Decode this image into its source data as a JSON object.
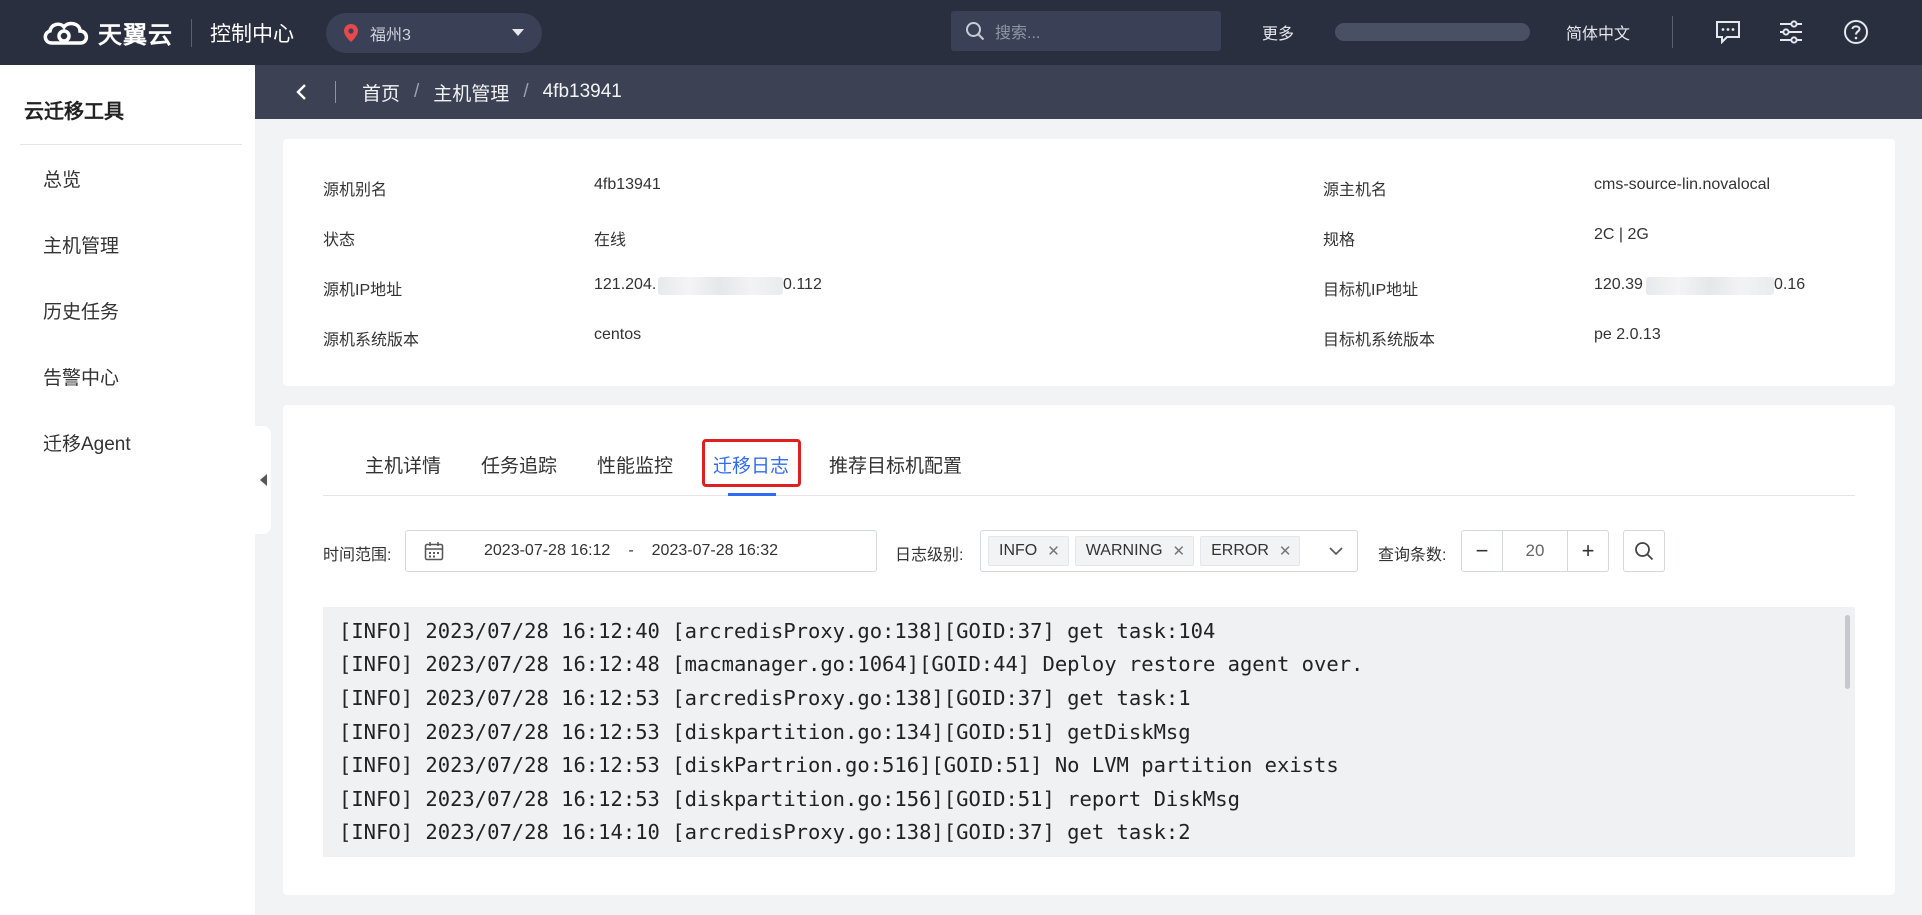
{
  "topbar": {
    "brand": "天翼云",
    "console": "控制中心",
    "region": "福州3",
    "search_placeholder": "搜索...",
    "more": "更多",
    "language": "简体中文"
  },
  "sidebar": {
    "title": "云迁移工具",
    "items": [
      {
        "label": "总览"
      },
      {
        "label": "主机管理"
      },
      {
        "label": "历史任务"
      },
      {
        "label": "告警中心"
      },
      {
        "label": "迁移Agent"
      }
    ]
  },
  "breadcrumb": [
    "首页",
    "主机管理",
    "4fb13941"
  ],
  "info": {
    "rows": [
      {
        "label_left": "源机别名",
        "value_left": "4fb13941",
        "label_right": "源主机名",
        "value_right": "cms-source-lin.novalocal"
      },
      {
        "label_left": "状态",
        "value_left": "在线",
        "label_right": "规格",
        "value_right": "2C | 2G"
      },
      {
        "label_left": "源机IP地址",
        "value_left_a": "121.204.",
        "value_left_b": "0.112",
        "label_right": "目标机IP地址",
        "value_right_a": "120.39",
        "value_right_b": "0.16"
      },
      {
        "label_left": "源机系统版本",
        "value_left": "centos",
        "label_right": "目标机系统版本",
        "value_right": "pe 2.0.13"
      }
    ]
  },
  "tabs": [
    {
      "label": "主机详情",
      "active": false
    },
    {
      "label": "任务追踪",
      "active": false
    },
    {
      "label": "性能监控",
      "active": false
    },
    {
      "label": "迁移日志",
      "active": true
    },
    {
      "label": "推荐目标机配置",
      "active": false
    }
  ],
  "filters": {
    "time_label": "时间范围:",
    "time_start": "2023-07-28 16:12",
    "time_sep": "-",
    "time_end": "2023-07-28 16:32",
    "level_label": "日志级别:",
    "levels": [
      "INFO",
      "WARNING",
      "ERROR"
    ],
    "count_label": "查询条数:",
    "count_value": "20",
    "minus": "−",
    "plus": "+"
  },
  "logs": [
    "[INFO] 2023/07/28 16:12:40 [arcredisProxy.go:138][GOID:37] get task:104",
    "[INFO] 2023/07/28 16:12:48 [macmanager.go:1064][GOID:44] Deploy restore agent over.",
    "[INFO] 2023/07/28 16:12:53 [arcredisProxy.go:138][GOID:37] get task:1",
    "[INFO] 2023/07/28 16:12:53 [diskpartition.go:134][GOID:51] getDiskMsg",
    "[INFO] 2023/07/28 16:12:53 [diskPartrion.go:516][GOID:51] No LVM partition exists",
    "[INFO] 2023/07/28 16:12:53 [diskpartition.go:156][GOID:51] report DiskMsg",
    "[INFO] 2023/07/28 16:14:10 [arcredisProxy.go:138][GOID:37] get task:2"
  ],
  "colors": {
    "topbar": "#2a2f3f",
    "breadcrumb_bar": "#3c4254",
    "accent": "#2f6cf6",
    "highlight_box": "#e02020",
    "region_pin": "#e5484d"
  },
  "icons": [
    "cloud-logo-icon",
    "location-pin-icon",
    "chevron-down-icon",
    "search-icon",
    "message-icon",
    "settings-sliders-icon",
    "help-icon",
    "back-arrow-icon",
    "calendar-icon",
    "close-icon",
    "collapse-arrow-icon"
  ]
}
